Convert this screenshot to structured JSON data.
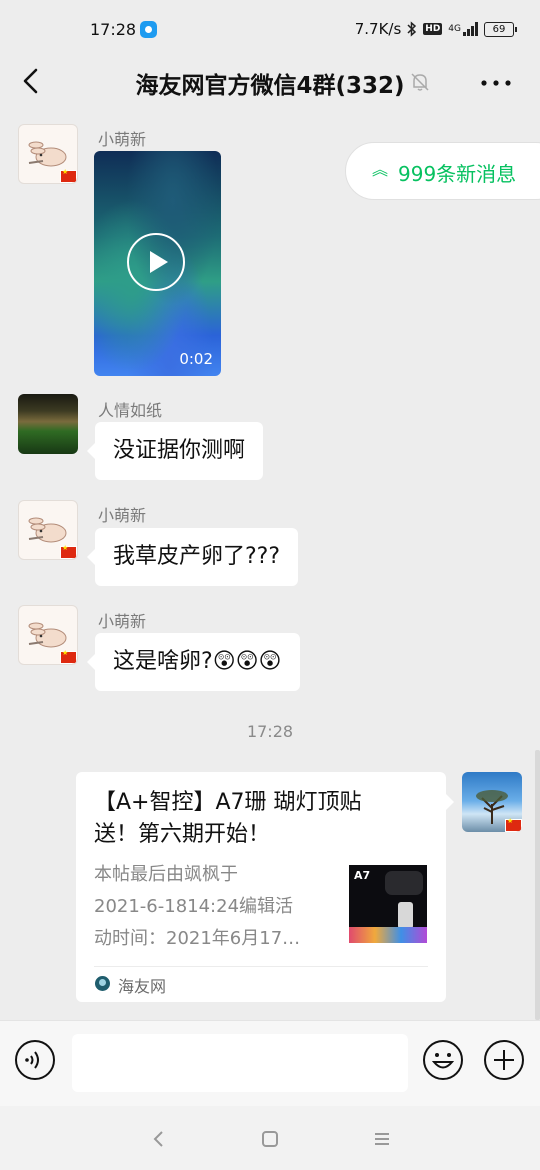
{
  "status_bar": {
    "time": "17:28",
    "network_speed": "7.7K/s",
    "hd_badge": "HD",
    "network_type": "4G",
    "battery": "69"
  },
  "header": {
    "title": "海友网官方微信4群(332)"
  },
  "new_messages": {
    "label": "999条新消息"
  },
  "messages": [
    {
      "sender": "小萌新",
      "type": "video",
      "duration": "0:02",
      "avatar_icon": "rabbit-avatar-icon"
    },
    {
      "sender": "人情如纸",
      "type": "text",
      "text": "没证据你测啊",
      "avatar_icon": "plant-avatar-icon"
    },
    {
      "sender": "小萌新",
      "type": "text",
      "text": "我草皮产卵了???",
      "avatar_icon": "rabbit-avatar-icon"
    },
    {
      "sender": "小萌新",
      "type": "text",
      "text": "这是啥卵?",
      "emojis": "😲😲😲",
      "avatar_icon": "rabbit-avatar-icon"
    }
  ],
  "timestamp": "17:28",
  "link_card": {
    "title": "【A+智控】A7珊 瑚灯顶贴\n送！第六期开始！",
    "description": "本帖最后由飒枫于\n2021-6-1814:24编辑活\n动时间：2021年6月17…",
    "thumbnail_label": "A7",
    "source": "海友网"
  },
  "colors": {
    "accent": "#07c160",
    "background": "#ededed"
  }
}
